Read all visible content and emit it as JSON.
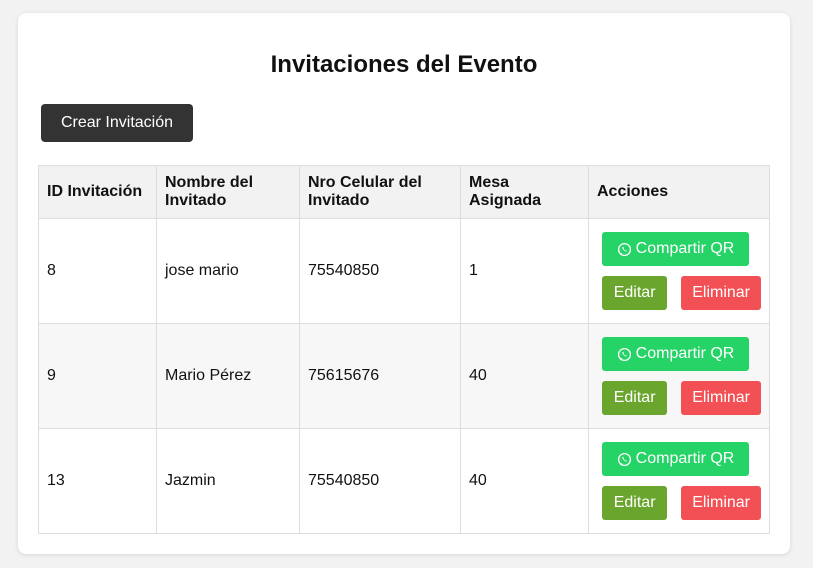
{
  "page": {
    "title": "Invitaciones del Evento",
    "create_label": "Crear Invitación"
  },
  "table": {
    "headers": [
      "ID Invitación",
      "Nombre del Invitado",
      "Nro Celular del Invitado",
      "Mesa Asignada",
      "Acciones"
    ],
    "rows": [
      {
        "id": "8",
        "name": "jose mario",
        "phone": "75540850",
        "table": "1"
      },
      {
        "id": "9",
        "name": "Mario Pérez",
        "phone": "75615676",
        "table": "40"
      },
      {
        "id": "13",
        "name": "Jazmin",
        "phone": "75540850",
        "table": "40"
      }
    ]
  },
  "actions": {
    "share_label": "Compartir QR",
    "share_icon": "whatsapp-icon",
    "edit_label": "Editar",
    "delete_label": "Eliminar"
  },
  "colors": {
    "share": "#25d366",
    "edit": "#6aa52e",
    "delete": "#f25054",
    "create": "#333333"
  }
}
